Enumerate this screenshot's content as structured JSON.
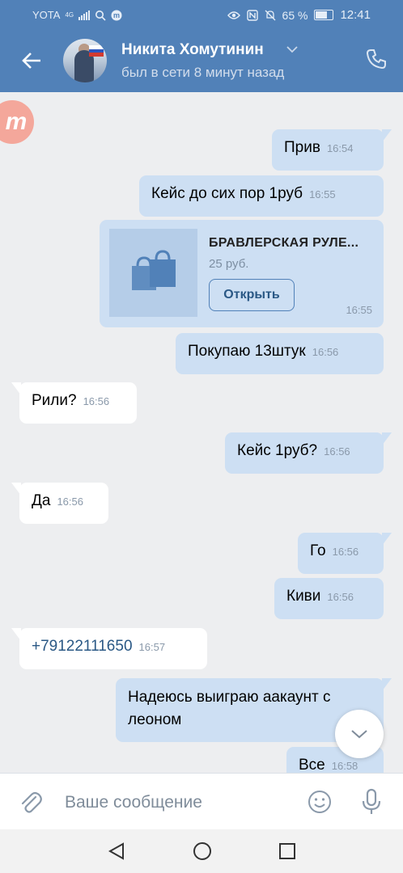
{
  "status_bar": {
    "carrier": "YOTA",
    "network": "4G",
    "battery_percent": "65 %",
    "time": "12:41"
  },
  "header": {
    "contact_name": "Никита Хомутинин",
    "last_seen": "был в сети 8 минут назад"
  },
  "messages": [
    {
      "dir": "out",
      "text": "Прив",
      "time": "16:54"
    },
    {
      "dir": "out",
      "text": "Кейс до сих пор 1руб",
      "time": "16:55"
    },
    {
      "dir": "out",
      "text": "Покупаю 13штук",
      "time": "16:56"
    },
    {
      "dir": "in",
      "text": "Рили?",
      "time": "16:56"
    },
    {
      "dir": "out",
      "text": "Кейс 1руб?",
      "time": "16:56"
    },
    {
      "dir": "in",
      "text": "Да",
      "time": "16:56"
    },
    {
      "dir": "out",
      "text": "Го",
      "time": "16:56"
    },
    {
      "dir": "out",
      "text": "Киви",
      "time": "16:56"
    },
    {
      "dir": "in",
      "text": "+79122111650",
      "time": "16:57"
    },
    {
      "dir": "out",
      "text": "Надеюсь выиграю аакаунт с леоном",
      "time": ""
    },
    {
      "dir": "out",
      "text": "Все",
      "time": "16:58"
    }
  ],
  "product_card": {
    "title": "БРАВЛЕРСКАЯ РУЛЕ...",
    "price": "25 руб.",
    "button_label": "Открыть",
    "time": "16:55"
  },
  "composer": {
    "placeholder": "Ваше сообщение"
  },
  "colors": {
    "header_bg": "#5181b8",
    "outgoing_bubble": "#cddff3",
    "incoming_bubble": "#ffffff",
    "chat_bg": "#edeef0",
    "link": "#2a5885"
  },
  "icons": [
    "back-arrow-icon",
    "chevron-down-icon",
    "phone-icon",
    "shopping-bags-icon",
    "chevron-down-icon",
    "paperclip-icon",
    "emoji-icon",
    "microphone-icon",
    "nav-back-icon",
    "nav-home-icon",
    "nav-recent-icon"
  ]
}
